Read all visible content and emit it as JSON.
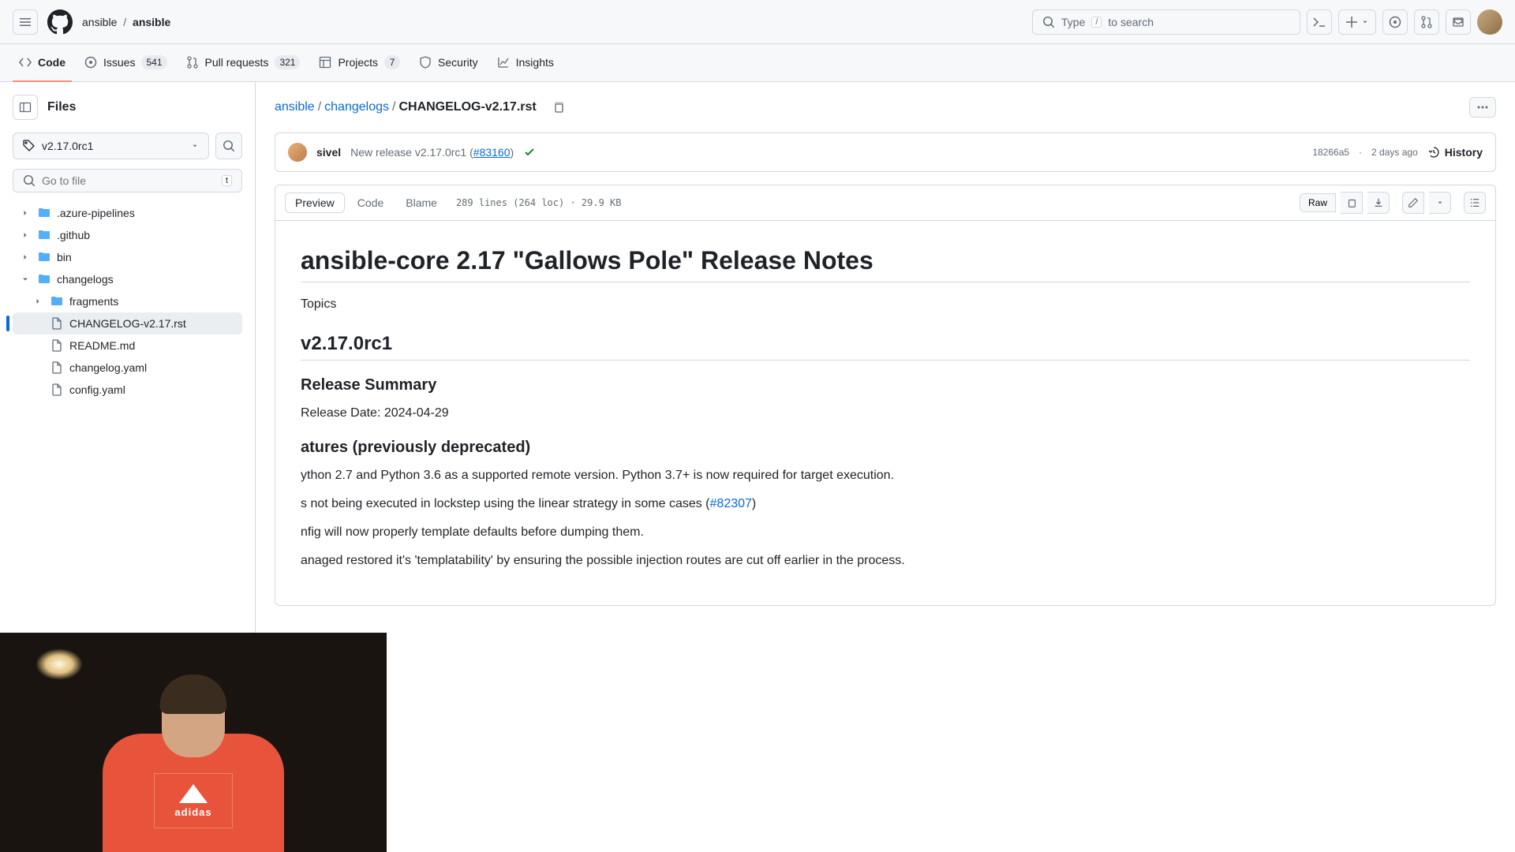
{
  "header": {
    "owner": "ansible",
    "repo": "ansible",
    "search_placeholder": "Type",
    "search_hint": "to search",
    "search_key": "/"
  },
  "nav": {
    "code": "Code",
    "issues": "Issues",
    "issues_count": "541",
    "pulls": "Pull requests",
    "pulls_count": "321",
    "projects": "Projects",
    "projects_count": "7",
    "security": "Security",
    "insights": "Insights"
  },
  "sidebar": {
    "title": "Files",
    "branch": "v2.17.0rc1",
    "filter_placeholder": "Go to file",
    "filter_key": "t",
    "tree": [
      {
        "name": ".azure-pipelines",
        "type": "folder",
        "depth": 0,
        "expanded": false
      },
      {
        "name": ".github",
        "type": "folder",
        "depth": 0,
        "expanded": false
      },
      {
        "name": "bin",
        "type": "folder",
        "depth": 0,
        "expanded": false
      },
      {
        "name": "changelogs",
        "type": "folder",
        "depth": 0,
        "expanded": true
      },
      {
        "name": "fragments",
        "type": "folder",
        "depth": 1,
        "expanded": false
      },
      {
        "name": "CHANGELOG-v2.17.rst",
        "type": "file",
        "depth": 1,
        "selected": true
      },
      {
        "name": "README.md",
        "type": "file",
        "depth": 1
      },
      {
        "name": "changelog.yaml",
        "type": "file",
        "depth": 1
      },
      {
        "name": "config.yaml",
        "type": "file",
        "depth": 1
      }
    ]
  },
  "path": {
    "root": "ansible",
    "folder": "changelogs",
    "file": "CHANGELOG-v2.17.rst"
  },
  "commit": {
    "author": "sivel",
    "message_prefix": "New release v2.17.0rc1 (",
    "pr_link": "#83160",
    "message_suffix": ")",
    "sha": "18266a5",
    "time": "2 days ago",
    "history": "History"
  },
  "file_toolbar": {
    "preview": "Preview",
    "code": "Code",
    "blame": "Blame",
    "stats": "289 lines (264 loc) · 29.9 KB",
    "raw": "Raw"
  },
  "doc": {
    "h1": "ansible-core 2.17 \"Gallows Pole\" Release Notes",
    "topics": "Topics",
    "h2_version": "v2.17.0rc1",
    "h3_summary": "Release Summary",
    "release_date": "Release Date: 2024-04-29",
    "h3_removed_partial": "atures (previously deprecated)",
    "removed_line_partial": "ython 2.7 and Python 3.6 as a supported remote version. Python 3.7+ is now required for target execution.",
    "bug1_prefix": "s not being executed in lockstep using the linear strategy in some cases (",
    "bug1_link": "#82307",
    "bug1_suffix": ")",
    "bug2_partial": "nfig will now properly template defaults before dumping them.",
    "bug3_partial": "anaged restored it's 'templatability' by ensuring the possible injection routes are cut off earlier in the process."
  },
  "webcam": {
    "logo_text": "adidas"
  }
}
